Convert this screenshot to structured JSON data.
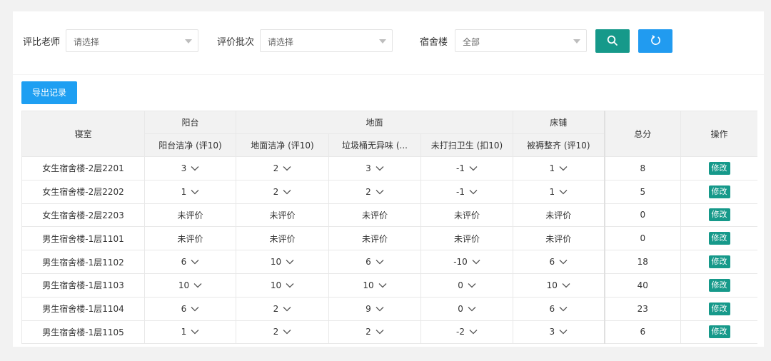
{
  "filters": {
    "teacher_label": "评比老师",
    "teacher_value": "请选择",
    "batch_label": "评价批次",
    "batch_value": "请选择",
    "building_label": "宿舍楼",
    "building_value": "全部"
  },
  "toolbar": {
    "search_icon": "search-icon",
    "refresh_icon": "refresh-icon",
    "export_label": "导出记录"
  },
  "colors": {
    "teal": "#16998a",
    "blue": "#219bf0"
  },
  "table": {
    "groups": {
      "room": "寝室",
      "balcony": "阳台",
      "floor": "地面",
      "bed": "床铺",
      "total": "总分",
      "action": "操作"
    },
    "subcols": {
      "balcony_clean": "阳台洁净 (评10)",
      "floor_clean": "地面洁净 (评10)",
      "trash": "垃圾桶无异味 (...",
      "no_clean": "未打扫卫生 (扣10)",
      "bedding": "被褥整齐 (评10)"
    },
    "edit_label": "修改",
    "rows": [
      {
        "room": "女生宿舍楼-2层2201",
        "c1": "3",
        "c2": "2",
        "c3": "3",
        "c4": "-1",
        "c5": "1",
        "total": "8",
        "sel": true
      },
      {
        "room": "女生宿舍楼-2层2202",
        "c1": "1",
        "c2": "2",
        "c3": "2",
        "c4": "-1",
        "c5": "1",
        "total": "5",
        "sel": true
      },
      {
        "room": "女生宿舍楼-2层2203",
        "c1": "未评价",
        "c2": "未评价",
        "c3": "未评价",
        "c4": "未评价",
        "c5": "未评价",
        "total": "0",
        "sel": false
      },
      {
        "room": "男生宿舍楼-1层1101",
        "c1": "未评价",
        "c2": "未评价",
        "c3": "未评价",
        "c4": "未评价",
        "c5": "未评价",
        "total": "0",
        "sel": false
      },
      {
        "room": "男生宿舍楼-1层1102",
        "c1": "6",
        "c2": "10",
        "c3": "6",
        "c4": "-10",
        "c5": "6",
        "total": "18",
        "sel": true
      },
      {
        "room": "男生宿舍楼-1层1103",
        "c1": "10",
        "c2": "10",
        "c3": "10",
        "c4": "0",
        "c5": "10",
        "total": "40",
        "sel": true
      },
      {
        "room": "男生宿舍楼-1层1104",
        "c1": "6",
        "c2": "2",
        "c3": "9",
        "c4": "0",
        "c5": "6",
        "total": "23",
        "sel": true
      },
      {
        "room": "男生宿舍楼-1层1105",
        "c1": "1",
        "c2": "2",
        "c3": "2",
        "c4": "-2",
        "c5": "3",
        "total": "6",
        "sel": true
      }
    ]
  }
}
